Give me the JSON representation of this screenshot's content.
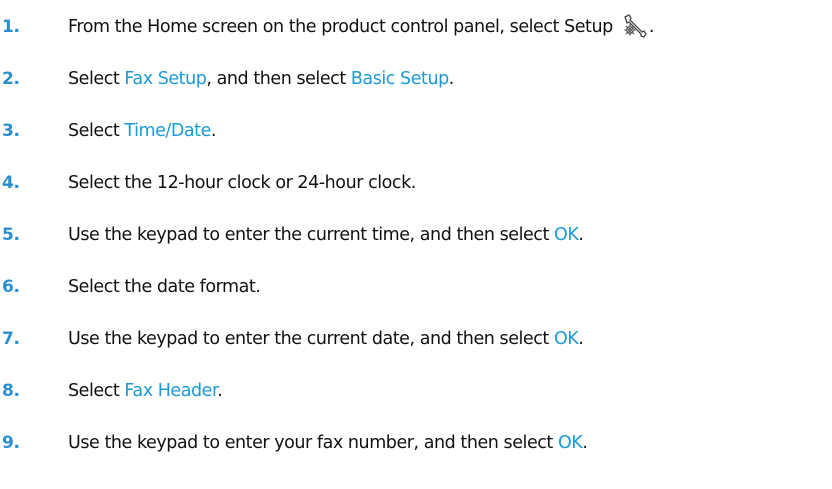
{
  "colors": {
    "step_number": "#2a8fd0",
    "link": "#1a9ad6",
    "text": "#111111"
  },
  "steps": [
    {
      "number": "1.",
      "parts": [
        "From the Home screen on the product control panel, select Setup ",
        "",
        ""
      ],
      "icon": "setup-wrench-gear-icon",
      "suffix": "."
    },
    {
      "number": "2.",
      "parts": [
        "Select ",
        "Fax Setup",
        ", and then select ",
        "Basic Setup",
        "."
      ]
    },
    {
      "number": "3.",
      "parts": [
        "Select ",
        "Time/Date",
        "."
      ]
    },
    {
      "number": "4.",
      "parts": [
        "Select the 12-hour clock or 24-hour clock."
      ]
    },
    {
      "number": "5.",
      "parts": [
        "Use the keypad to enter the current time, and then select ",
        "OK",
        "."
      ]
    },
    {
      "number": "6.",
      "parts": [
        "Select the date format."
      ]
    },
    {
      "number": "7.",
      "parts": [
        "Use the keypad to enter the current date, and then select ",
        "OK",
        "."
      ]
    },
    {
      "number": "8.",
      "parts": [
        "Select ",
        "Fax Header",
        "."
      ]
    },
    {
      "number": "9.",
      "parts": [
        "Use the keypad to enter your fax number, and then select ",
        "OK",
        "."
      ]
    }
  ]
}
